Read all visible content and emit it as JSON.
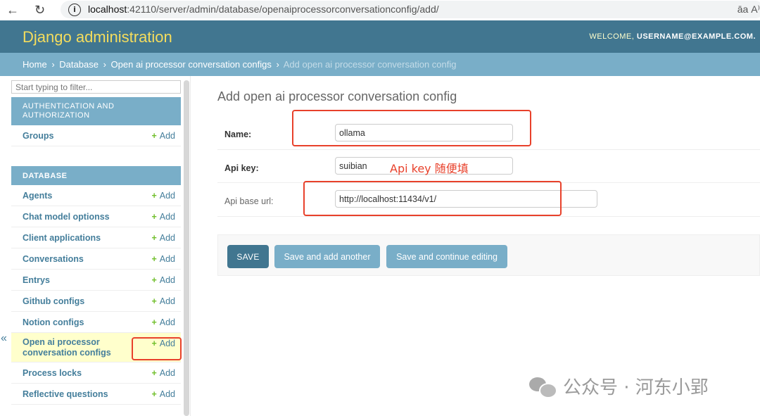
{
  "browser": {
    "url_host": "localhost",
    "url_path": ":42110/server/admin/database/openaiprocessorconversationconfig/add/",
    "info_icon": "i",
    "read_aloud": "ǝa A⁾"
  },
  "header": {
    "brand": "Django administration",
    "welcome_label": "WELCOME,",
    "username": "USERNAME@EXAMPLE.COM."
  },
  "breadcrumbs": {
    "home": "Home",
    "app": "Database",
    "model": "Open ai processor conversation configs",
    "current": "Add open ai processor conversation config",
    "separator": "›"
  },
  "sidebar": {
    "filter_placeholder": "Start typing to filter...",
    "collapse_glyph": "«",
    "add_label": "Add",
    "modules": [
      {
        "caption": "AUTHENTICATION AND AUTHORIZATION",
        "items": [
          {
            "name": "Groups"
          }
        ]
      },
      {
        "caption": "DATABASE",
        "items": [
          {
            "name": "Agents"
          },
          {
            "name": "Chat model optionss"
          },
          {
            "name": "Client applications"
          },
          {
            "name": "Conversations"
          },
          {
            "name": "Entrys"
          },
          {
            "name": "Github configs"
          },
          {
            "name": "Notion configs"
          },
          {
            "name": "Open ai processor conversation configs"
          },
          {
            "name": "Process locks"
          },
          {
            "name": "Reflective questions"
          }
        ]
      }
    ]
  },
  "main": {
    "title": "Add open ai processor conversation config",
    "fields": {
      "name": {
        "label": "Name:",
        "value": "ollama"
      },
      "api_key": {
        "label": "Api key:",
        "value": "suibian"
      },
      "api_base_url": {
        "label": "Api base url:",
        "value": "http://localhost:11434/v1/"
      }
    },
    "buttons": {
      "save": "SAVE",
      "save_add_another": "Save and add another",
      "save_continue": "Save and continue editing"
    }
  },
  "annotation": {
    "api_key_note": "Api key 随便填",
    "color": "#e8412b"
  },
  "watermark": {
    "text": "公众号 · 河东小郢"
  },
  "colors": {
    "header_bg": "#417690",
    "brand": "#f5dd5d",
    "breadcrumbs_bg": "#79aec8",
    "link": "#447e9b",
    "add_plus": "#70bf2b",
    "current_row": "#ffffcc"
  }
}
